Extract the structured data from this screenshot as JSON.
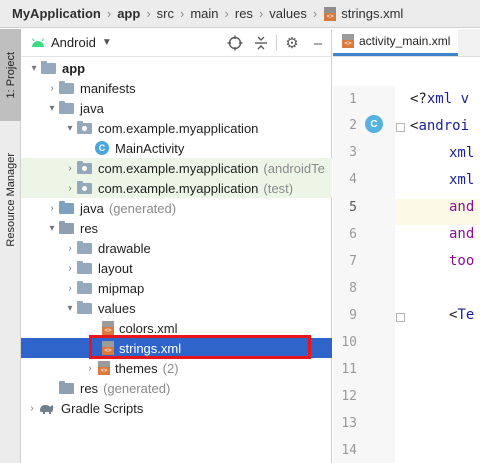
{
  "breadcrumb": {
    "items": [
      "MyApplication",
      "app",
      "src",
      "main",
      "res",
      "values",
      "strings.xml"
    ]
  },
  "tool_strip": {
    "project_tab": "1: Project",
    "resource_tab": "Resource Manager"
  },
  "project_panel": {
    "view_selector": "Android",
    "header_icons": [
      "crosshair-icon",
      "collapse-icon",
      "settings-icon",
      "minimize-icon"
    ],
    "tree": [
      {
        "label": "app",
        "expanded": true
      },
      {
        "label": "manifests",
        "expanded": false
      },
      {
        "label": "java",
        "expanded": true
      },
      {
        "label": "com.example.myapplication",
        "expanded": true
      },
      {
        "label": "MainActivity"
      },
      {
        "label": "com.example.myapplication",
        "suffix": "(androidTe",
        "expanded": false
      },
      {
        "label": "com.example.myapplication",
        "suffix": "(test)",
        "expanded": false
      },
      {
        "label": "java",
        "suffix": "(generated)",
        "expanded": false
      },
      {
        "label": "res",
        "expanded": true
      },
      {
        "label": "drawable",
        "expanded": false
      },
      {
        "label": "layout",
        "expanded": false
      },
      {
        "label": "mipmap",
        "expanded": false
      },
      {
        "label": "values",
        "expanded": true
      },
      {
        "label": "colors.xml"
      },
      {
        "label": "strings.xml",
        "selected": true
      },
      {
        "label": "themes",
        "suffix": "(2)",
        "expanded": false
      },
      {
        "label": "res",
        "suffix": "(generated)"
      },
      {
        "label": "Gradle Scripts",
        "expanded": false
      }
    ]
  },
  "editor": {
    "tab_label": "activity_main.xml",
    "line_numbers": [
      "1",
      "2",
      "3",
      "4",
      "5",
      "6",
      "7",
      "8",
      "9",
      "10",
      "11",
      "12",
      "13",
      "14"
    ],
    "current_line": "5",
    "gutter_icon": "C",
    "code": {
      "line1_punc": "<?",
      "line1_text": "xml v",
      "line2_punc": "<",
      "line2_text": "androi",
      "line3": "xml",
      "line4": "xml",
      "line5": "and",
      "line6": "and",
      "line7": "too",
      "line9_punc": "<",
      "line9_text": "Te"
    }
  },
  "colors": {
    "selection": "#2f65ca",
    "highlight_box": "#e8151b",
    "test_rows": "#edf6e6",
    "xml_tag": "#1b1f9a",
    "xml_attr": "#871094"
  }
}
